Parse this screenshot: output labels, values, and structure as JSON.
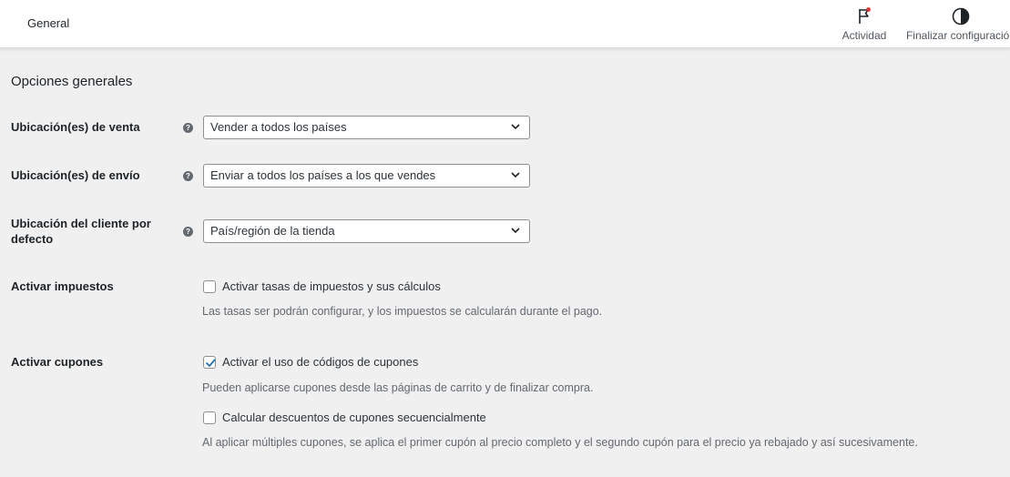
{
  "header": {
    "title": "General",
    "actions": [
      {
        "label": "Actividad",
        "icon": "flag-icon",
        "has_notification": true,
        "notification_color": "#d63638"
      },
      {
        "label": "Finalizar configuración",
        "icon": "half-circle-icon"
      }
    ]
  },
  "section": {
    "title": "Opciones generales"
  },
  "settings": {
    "sell_locations": {
      "label": "Ubicación(es) de venta",
      "value": "Vender a todos los países"
    },
    "ship_locations": {
      "label": "Ubicación(es) de envío",
      "value": "Enviar a todos los países a los que vendes"
    },
    "default_customer_location": {
      "label": "Ubicación del cliente por defecto",
      "value": "País/región de la tienda"
    },
    "enable_taxes": {
      "label": "Activar impuestos",
      "checkbox_label": "Activar tasas de impuestos y sus cálculos",
      "checked": false,
      "description": "Las tasas ser podrán configurar, y los impuestos se calcularán durante el pago."
    },
    "enable_coupons": {
      "label": "Activar cupones",
      "checkbox_label": "Activar el uso de códigos de cupones",
      "checked": true,
      "description": "Pueden aplicarse cupones desde las páginas de carrito y de finalizar compra.",
      "sequential": {
        "checkbox_label": "Calcular descuentos de cupones secuencialmente",
        "checked": false,
        "description": "Al aplicar múltiples cupones, se aplica el primer cupón al precio completo y el segundo cupón para el precio ya rebajado y así sucesivamente."
      }
    }
  },
  "colors": {
    "accent": "#2271b1",
    "background": "#f0f0f1",
    "text": "#1d2327",
    "muted": "#646970"
  }
}
